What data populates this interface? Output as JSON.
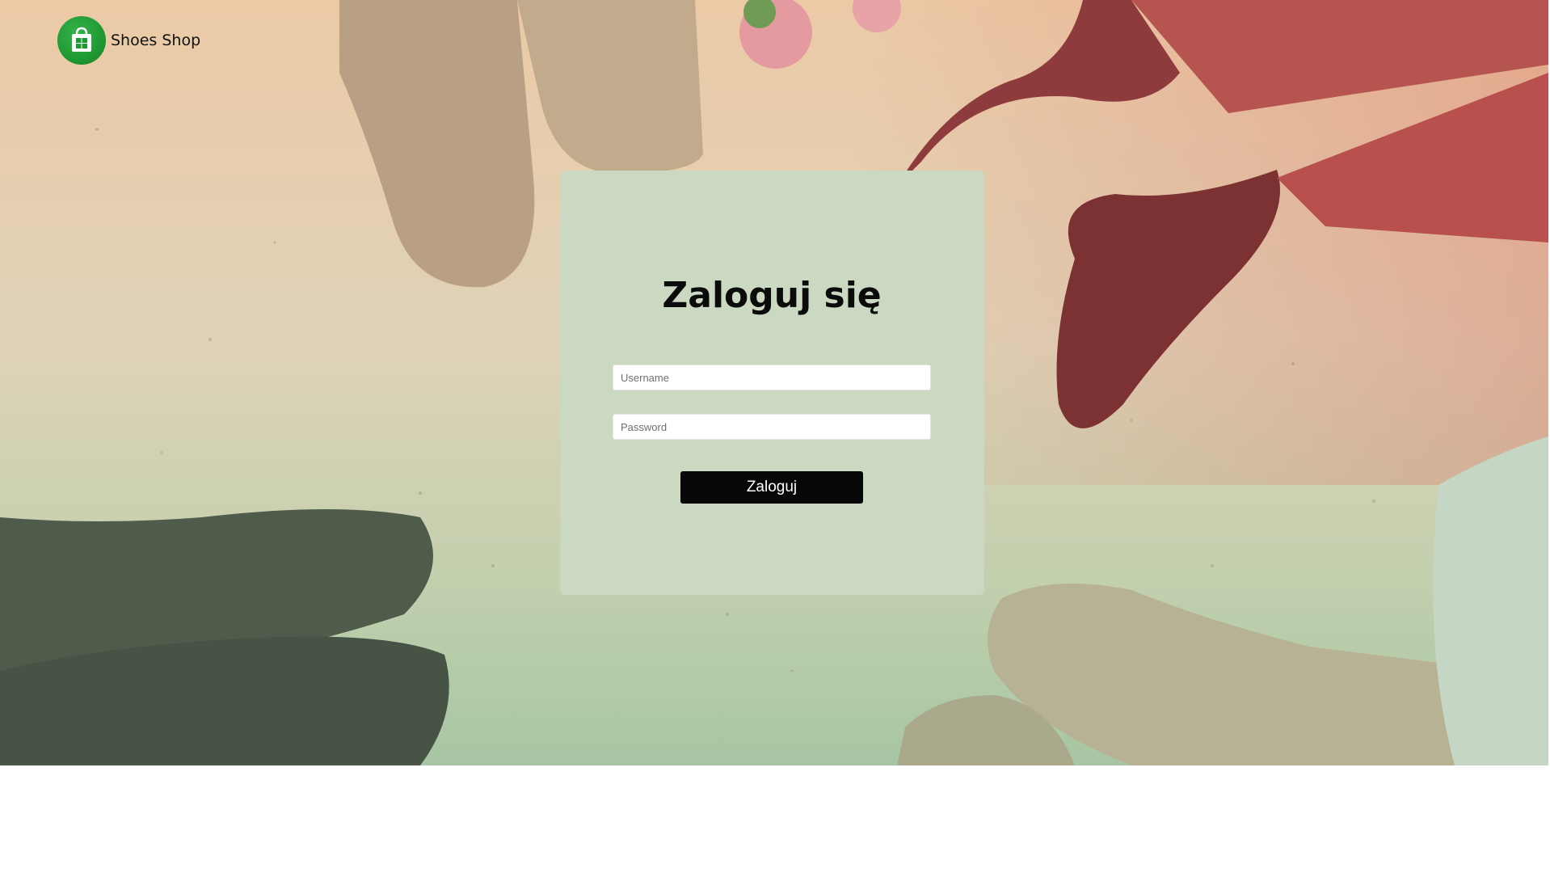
{
  "header": {
    "brand_name": "Shoes Shop",
    "logo_icon": "shopping-bag-icon",
    "logo_color": "#1f9a33"
  },
  "login": {
    "title": "Zaloguj się",
    "username_placeholder": "Username",
    "password_placeholder": "Password",
    "submit_label": "Zaloguj",
    "card_color": "#cbd8c2",
    "button_color": "#070707"
  }
}
